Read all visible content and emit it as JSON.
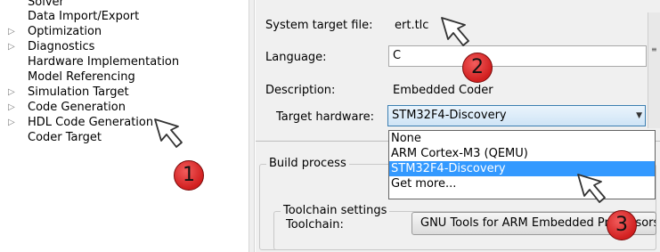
{
  "tree": {
    "items": [
      {
        "label": "Solver",
        "expandable": false
      },
      {
        "label": "Data Import/Export",
        "expandable": false
      },
      {
        "label": "Optimization",
        "expandable": true
      },
      {
        "label": "Diagnostics",
        "expandable": true
      },
      {
        "label": "Hardware Implementation",
        "expandable": false
      },
      {
        "label": "Model Referencing",
        "expandable": false
      },
      {
        "label": "Simulation Target",
        "expandable": true
      },
      {
        "label": "Code Generation",
        "expandable": true
      },
      {
        "label": "HDL Code Generation",
        "expandable": true
      },
      {
        "label": "Coder Target",
        "expandable": false
      }
    ],
    "expander_glyph": "▷"
  },
  "target": {
    "system_target_label": "System target file:",
    "system_target_value": "ert.tlc",
    "language_label": "Language:",
    "language_value": "C",
    "description_label": "Description:",
    "description_value": "Embedded Coder",
    "hardware_label": "Target hardware:",
    "hardware_value": "STM32F4-Discovery",
    "dropdown_arrow": "▼",
    "scroll_grip": "≡"
  },
  "hardware_dropdown": {
    "options": [
      "None",
      "ARM Cortex-M3 (QEMU)",
      "STM32F4-Discovery",
      "Get more..."
    ],
    "highlighted": "STM32F4-Discovery"
  },
  "build": {
    "group_label": "Build process",
    "toolchain_group_label": "Toolchain settings",
    "toolchain_label": "Toolchain:",
    "toolchain_value": "GNU Tools for ARM Embedded Processors"
  },
  "annotations": [
    "1",
    "2",
    "3"
  ],
  "colors": {
    "highlight": "#3399ff",
    "badge_red": "#d11f1f",
    "combo_border": "#3c7fb1"
  }
}
